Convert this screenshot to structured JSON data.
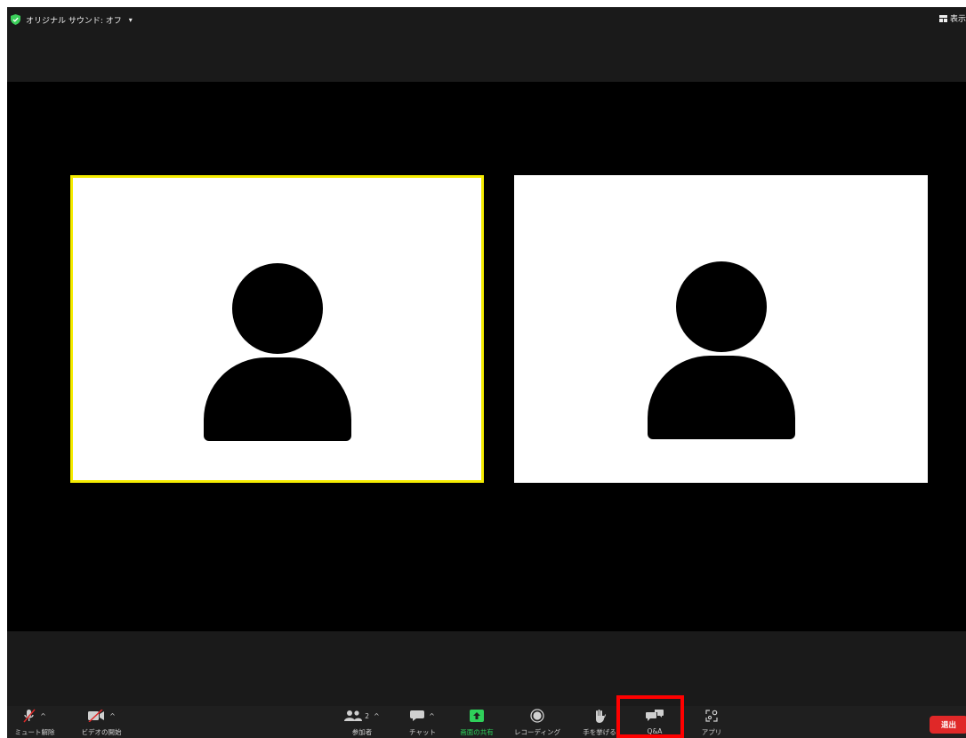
{
  "topbar": {
    "sound_label": "オリジナル サウンド: オフ",
    "sound_caret": "▾",
    "view_label": "表示"
  },
  "colors": {
    "active_speaker_border": "#f5ec00",
    "share_green": "#2fd05a",
    "shield_green": "#3ccf5b",
    "leave_red": "#e02828",
    "highlight_red": "#ff0000"
  },
  "participants": [
    {
      "icon": "person-avatar",
      "active_speaker": true
    },
    {
      "icon": "person-avatar",
      "active_speaker": false
    }
  ],
  "toolbar": {
    "unmute_label": "ミュート解除",
    "start_video_label": "ビデオの開始",
    "participants_label": "参加者",
    "participants_count": "2",
    "chat_label": "チャット",
    "share_label": "画面の共有",
    "record_label": "レコーディング",
    "raise_hand_label": "手を挙げる",
    "qa_label": "Q&A",
    "apps_label": "アプリ",
    "chevron": "^"
  },
  "leave_label": "退出"
}
